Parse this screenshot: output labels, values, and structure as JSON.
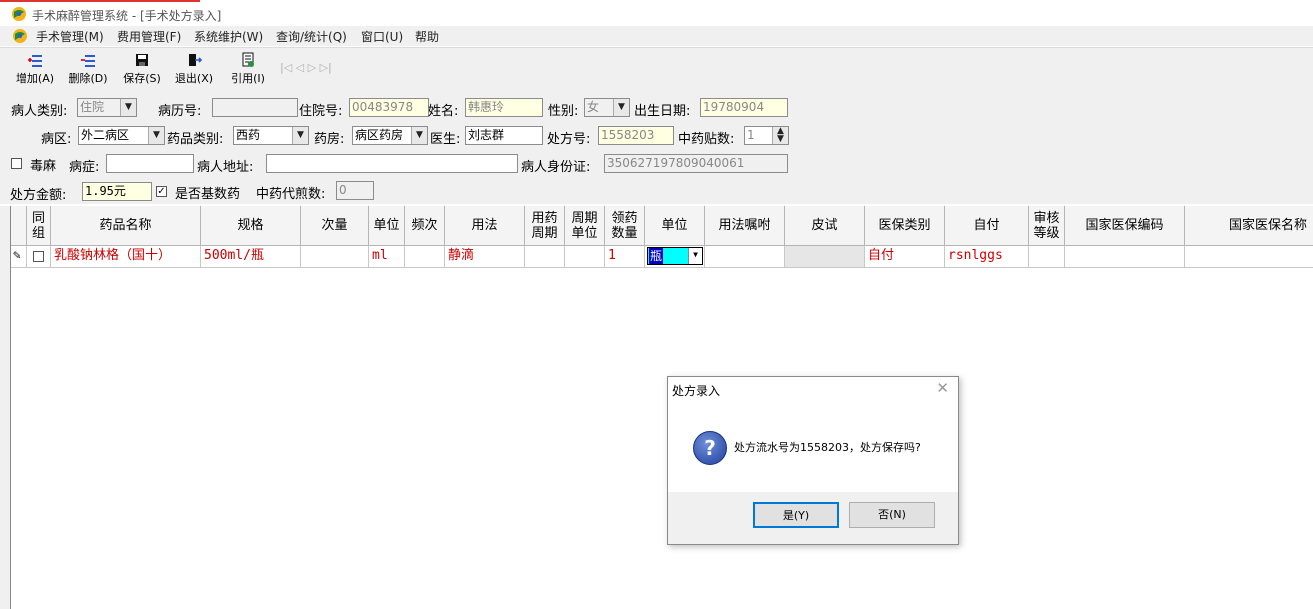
{
  "window": {
    "title": "手术麻醉管理系统 - [手术处方录入]"
  },
  "menu": [
    "手术管理(M)",
    "费用管理(F)",
    "系统维护(W)",
    "查询/统计(Q)",
    "窗口(U)",
    "帮助"
  ],
  "toolbar": {
    "buttons": [
      {
        "label": "增加(A)",
        "icon": "add-row-icon"
      },
      {
        "label": "删除(D)",
        "icon": "delete-row-icon"
      },
      {
        "label": "保存(S)",
        "icon": "save-icon"
      },
      {
        "label": "退出(X)",
        "icon": "exit-icon"
      },
      {
        "label": "引用(I)",
        "icon": "reference-icon"
      }
    ],
    "nav_glyphs": "|◁  ◁  ▷  ▷|"
  },
  "form": {
    "patient_type_label": "病人类别:",
    "patient_type_value": "住院",
    "record_no_label": "病历号:",
    "record_no_value": "",
    "admission_no_label": "住院号:",
    "admission_no_value": "00483978",
    "name_label": "姓名:",
    "name_value": "韩惠玲",
    "gender_label": "性别:",
    "gender_value": "女",
    "birth_label": "出生日期:",
    "birth_value": "19780904",
    "ward_label": "病区:",
    "ward_value": "外二病区",
    "drug_category_label": "药品类别:",
    "drug_category_value": "西药",
    "pharmacy_label": "药房:",
    "pharmacy_value": "病区药房",
    "doctor_label": "医生:",
    "doctor_value": "刘志群",
    "prescription_no_label": "处方号:",
    "prescription_no_value": "1558203",
    "tcm_count_label": "中药贴数:",
    "tcm_count_value": "1",
    "narcotic_label": "毒麻",
    "narcotic_checked": false,
    "disease_label": "病症:",
    "disease_value": "",
    "address_label": "病人地址:",
    "address_value": "",
    "id_card_label": "病人身份证:",
    "id_card_value": "350627197809040061",
    "amount_label": "处方金额:",
    "amount_value": "1.95元",
    "basic_drug_label": "是否基数药",
    "basic_drug_checked": true,
    "tcm_decoct_label": "中药代煎数:",
    "tcm_decoct_value": "0"
  },
  "grid": {
    "columns": [
      "同组",
      "药品名称",
      "规格",
      "次量",
      "单位",
      "频次",
      "用法",
      "用药周期",
      "周期单位",
      "领药数量",
      "单位",
      "用法嘱咐",
      "皮试",
      "医保类别",
      "自付",
      "审核等级",
      "国家医保编码",
      "国家医保名称"
    ],
    "rows": [
      {
        "group_checked": false,
        "drug_name": "乳酸钠林格（国十）",
        "spec": "500ml/瓶",
        "dose": "",
        "unit": "ml",
        "frequency": "",
        "usage": "静滴",
        "period": "",
        "period_unit": "",
        "quantity": "1",
        "qty_unit": "瓶",
        "instruction": "",
        "skin_test": "",
        "insurance_type": "自付",
        "self_pay": "rsnlggs",
        "audit_level": "",
        "national_code": "",
        "national_name": ""
      }
    ]
  },
  "dialog": {
    "title": "处方录入",
    "message": "处方流水号为1558203，处方保存吗?",
    "yes_label": "是(Y)",
    "no_label": "否(N)",
    "close_glyph": "✕",
    "icon": "question-icon"
  }
}
